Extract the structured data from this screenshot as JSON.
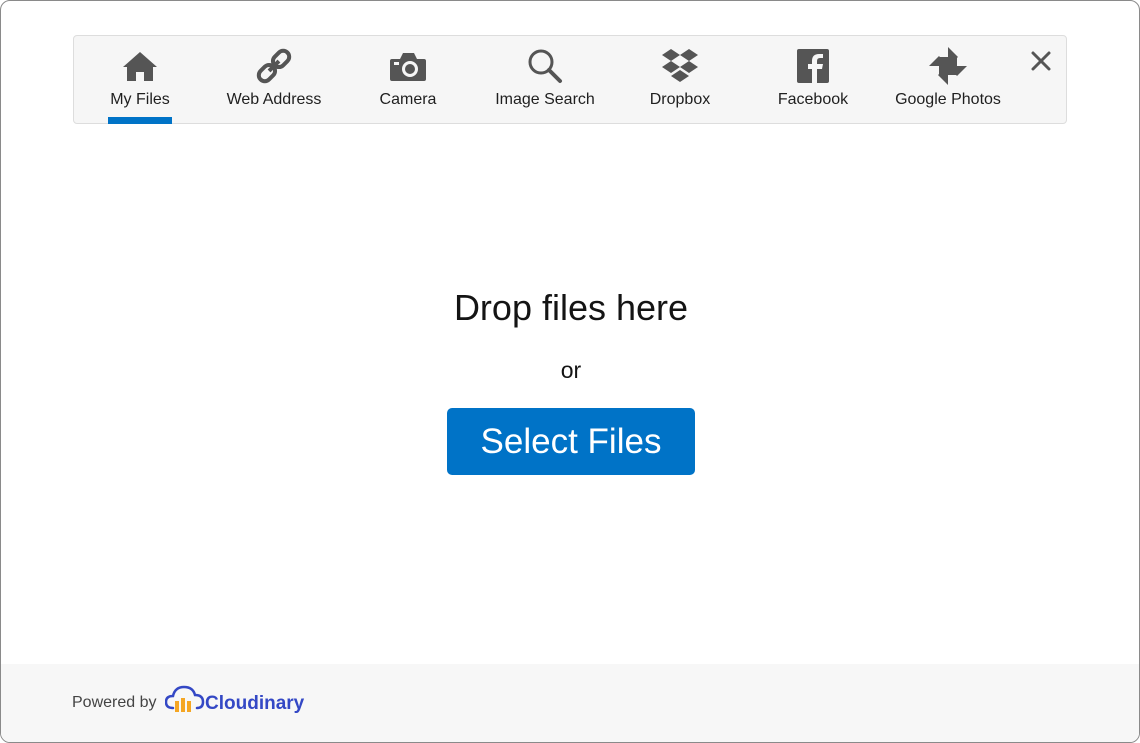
{
  "tabs": [
    {
      "id": "my-files",
      "label": "My Files",
      "icon": "home-icon",
      "active": true
    },
    {
      "id": "web-address",
      "label": "Web Address",
      "icon": "link-icon",
      "active": false
    },
    {
      "id": "camera",
      "label": "Camera",
      "icon": "camera-icon",
      "active": false
    },
    {
      "id": "image-search",
      "label": "Image Search",
      "icon": "search-icon",
      "active": false
    },
    {
      "id": "dropbox",
      "label": "Dropbox",
      "icon": "dropbox-icon",
      "active": false
    },
    {
      "id": "facebook",
      "label": "Facebook",
      "icon": "facebook-icon",
      "active": false
    },
    {
      "id": "google-photos",
      "label": "Google Photos",
      "icon": "google-photos-icon",
      "active": false
    }
  ],
  "close_icon": "close-icon",
  "main": {
    "drop_title": "Drop files here",
    "or_text": "or",
    "select_button": "Select Files"
  },
  "footer": {
    "powered_by": "Powered by",
    "brand_name": "Cloudinary",
    "brand_icon": "cloudinary-logo-icon"
  },
  "colors": {
    "accent": "#0073c7",
    "icon": "#555555",
    "brand": "#3448c5",
    "brand_orange": "#f5a623"
  }
}
